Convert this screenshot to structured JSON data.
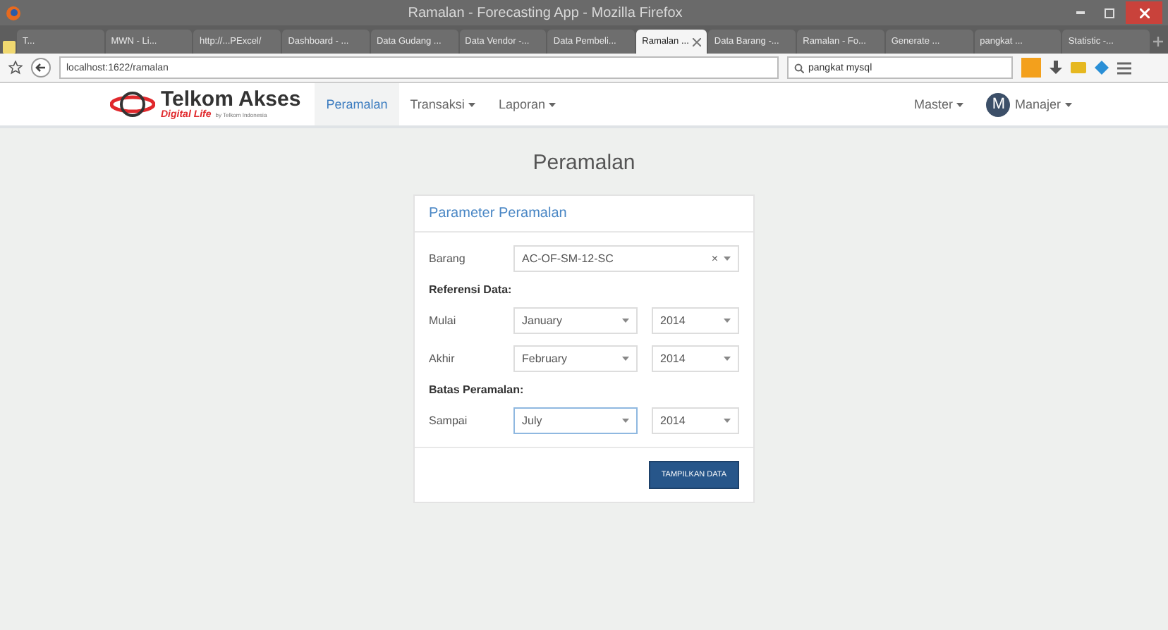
{
  "browser": {
    "title": "Ramalan - Forecasting App - Mozilla Firefox",
    "tabs": [
      {
        "label": "T...",
        "selected": false
      },
      {
        "label": "MWN - Li...",
        "selected": false
      },
      {
        "label": "http://...PExcel/",
        "selected": false
      },
      {
        "label": "Dashboard - ...",
        "selected": false
      },
      {
        "label": "Data Gudang ...",
        "selected": false
      },
      {
        "label": "Data Vendor -...",
        "selected": false
      },
      {
        "label": "Data Pembeli...",
        "selected": false
      },
      {
        "label": "Ramalan ...",
        "selected": true
      },
      {
        "label": "Data Barang -...",
        "selected": false
      },
      {
        "label": "Ramalan - Fo...",
        "selected": false
      },
      {
        "label": "Generate ...",
        "selected": false
      },
      {
        "label": "pangkat ...",
        "selected": false
      },
      {
        "label": "Statistic -...",
        "selected": false
      }
    ],
    "url": "localhost:1622/ramalan",
    "search": "pangkat mysql"
  },
  "app": {
    "brand": {
      "name": "Telkom Akses",
      "tagline": "Digital Life",
      "by": "by Telkom Indonesia"
    },
    "nav": [
      {
        "label": "Peramalan",
        "selected": true,
        "dropdown": false
      },
      {
        "label": "Transaksi",
        "selected": false,
        "dropdown": true
      },
      {
        "label": "Laporan",
        "selected": false,
        "dropdown": true
      }
    ],
    "master": {
      "label": "Master",
      "dropdown": true
    },
    "user": {
      "initial": "M",
      "name": "Manajer"
    }
  },
  "page": {
    "heading": "Peramalan",
    "card": {
      "title": "Parameter Peramalan",
      "rows": [
        {
          "kind": "field",
          "label": "Barang",
          "selects": [
            {
              "value": "AC-OF-SM-12-SC",
              "clear": "×",
              "focused": false
            }
          ]
        },
        {
          "kind": "heading",
          "label": "Referensi Data:"
        },
        {
          "kind": "field",
          "label": "Mulai",
          "selects": [
            {
              "value": "January",
              "focused": false
            },
            {
              "value": "2014",
              "focused": false
            }
          ]
        },
        {
          "kind": "field",
          "label": "Akhir",
          "selects": [
            {
              "value": "February",
              "focused": false
            },
            {
              "value": "2014",
              "focused": false
            }
          ]
        },
        {
          "kind": "heading",
          "label": "Batas Peramalan:"
        },
        {
          "kind": "field",
          "label": "Sampai",
          "selects": [
            {
              "value": "July",
              "focused": true
            },
            {
              "value": "2014",
              "focused": false
            }
          ]
        }
      ],
      "button": "TAMPILKAN DATA"
    }
  }
}
